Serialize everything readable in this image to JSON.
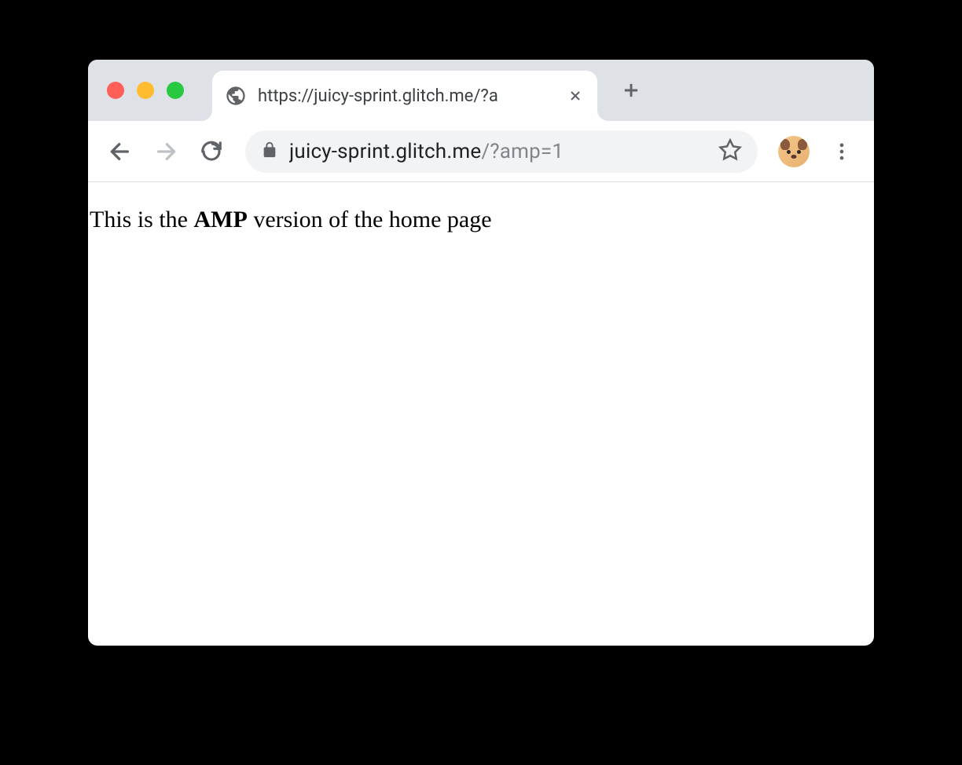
{
  "tab": {
    "title": "https://juicy-sprint.glitch.me/?a"
  },
  "address": {
    "domain": "juicy-sprint.glitch.me",
    "query": "/?amp=1"
  },
  "content": {
    "prefix": "This is the ",
    "bold": "AMP",
    "suffix": " version of the home page"
  }
}
